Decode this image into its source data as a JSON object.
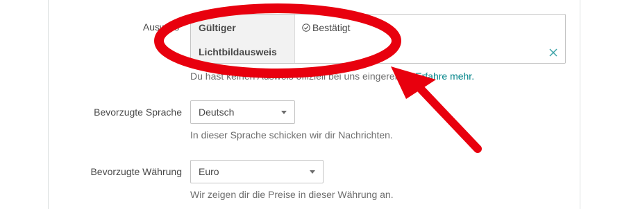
{
  "identity": {
    "label": "Ausweis",
    "id_title_line1": "Gültiger",
    "id_title_line2": "Lichtbildausweis",
    "status": "Bestätigt",
    "help_text": "Du hast keinen Ausweis offiziell bei uns eingereicht.",
    "help_link": "Erfahre mehr."
  },
  "language": {
    "label": "Bevorzugte Sprache",
    "value": "Deutsch",
    "help_text": "In dieser Sprache schicken wir dir Nachrichten."
  },
  "currency": {
    "label": "Bevorzugte Währung",
    "value": "Euro",
    "help_text": "Wir zeigen dir die Preise in dieser Währung an."
  },
  "colors": {
    "annotation": "#e8000e",
    "link": "#008489",
    "close_icon": "#3ea3a8"
  }
}
